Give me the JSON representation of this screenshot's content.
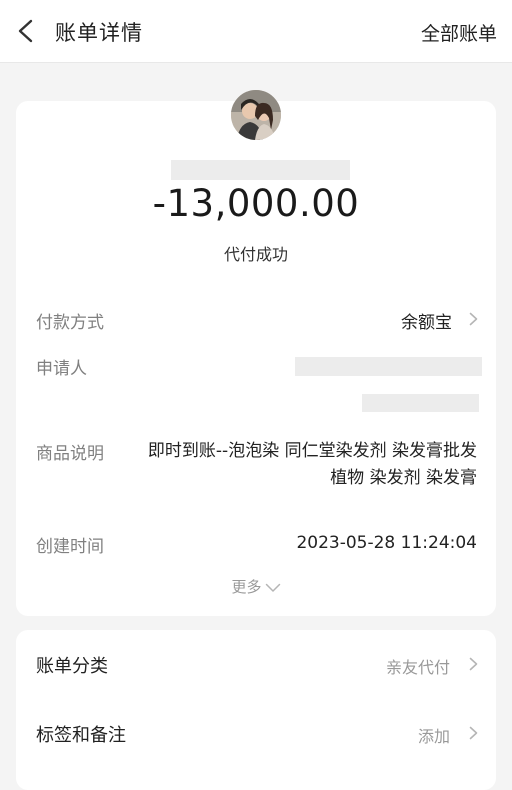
{
  "nav": {
    "title": "账单详情",
    "right_link": "全部账单"
  },
  "summary": {
    "amount": "-13,000.00",
    "status": "代付成功"
  },
  "details": {
    "payment_method_label": "付款方式",
    "payment_method_value": "余额宝",
    "applicant_label": "申请人",
    "product_label": "商品说明",
    "product_value": "即时到账--泡泡染 同仁堂染发剂 染发膏批发植物 染发剂 染发膏",
    "created_label": "创建时间",
    "created_value": "2023-05-28 11:24:04",
    "more_label": "更多"
  },
  "extra": {
    "category_label": "账单分类",
    "category_value": "亲友代付",
    "tags_label": "标签和备注",
    "tags_value": "添加"
  },
  "icons": {
    "back": "chevron-left-icon",
    "row_arrow": "chevron-right-icon",
    "more_arrow": "chevron-down-icon"
  },
  "colors": {
    "background": "#f4f4f4",
    "card": "#ffffff",
    "label": "#808080",
    "muted": "#999999",
    "redaction": "#ececec"
  }
}
